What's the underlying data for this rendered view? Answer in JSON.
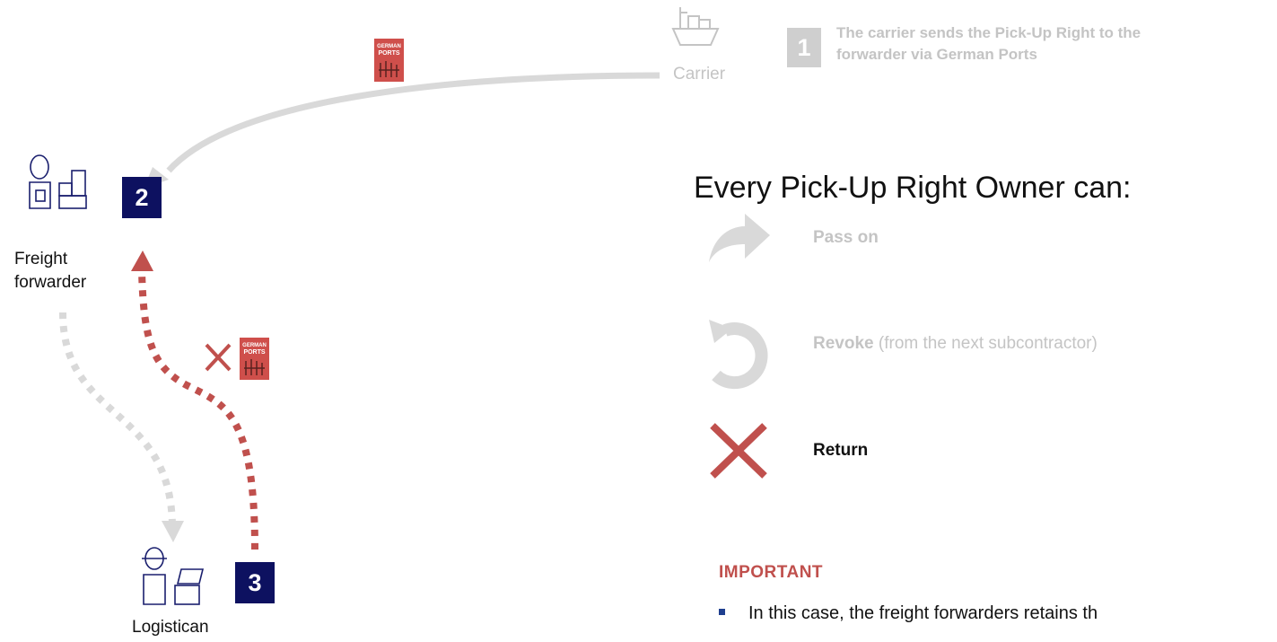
{
  "actors": {
    "carrier": "Carrier",
    "forwarder_line1": "Freight",
    "forwarder_line2": "forwarder",
    "logistican": "Logistican"
  },
  "steps": {
    "step1": "1",
    "step2": "2",
    "step3": "3"
  },
  "step1_note": {
    "line1": "The carrier sends the Pick-Up Right to the",
    "line2": "forwarder via German Ports"
  },
  "headline": "Every Pick-Up Right Owner can:",
  "actions": {
    "pass_on": "Pass on",
    "revoke_bold": "Revoke",
    "revoke_rest": " (from the next subcontractor)",
    "return": "Return"
  },
  "important": {
    "title": "IMPORTANT",
    "bullet": "In this case, the freight forwarders retains th"
  },
  "document_logo": {
    "line1": "GERMAN",
    "line2": "PORTS"
  },
  "colors": {
    "navy": "#0d1160",
    "red": "#c0504d",
    "light_gray": "#c4c4c4",
    "arrow_gray": "#d9d9d9"
  }
}
